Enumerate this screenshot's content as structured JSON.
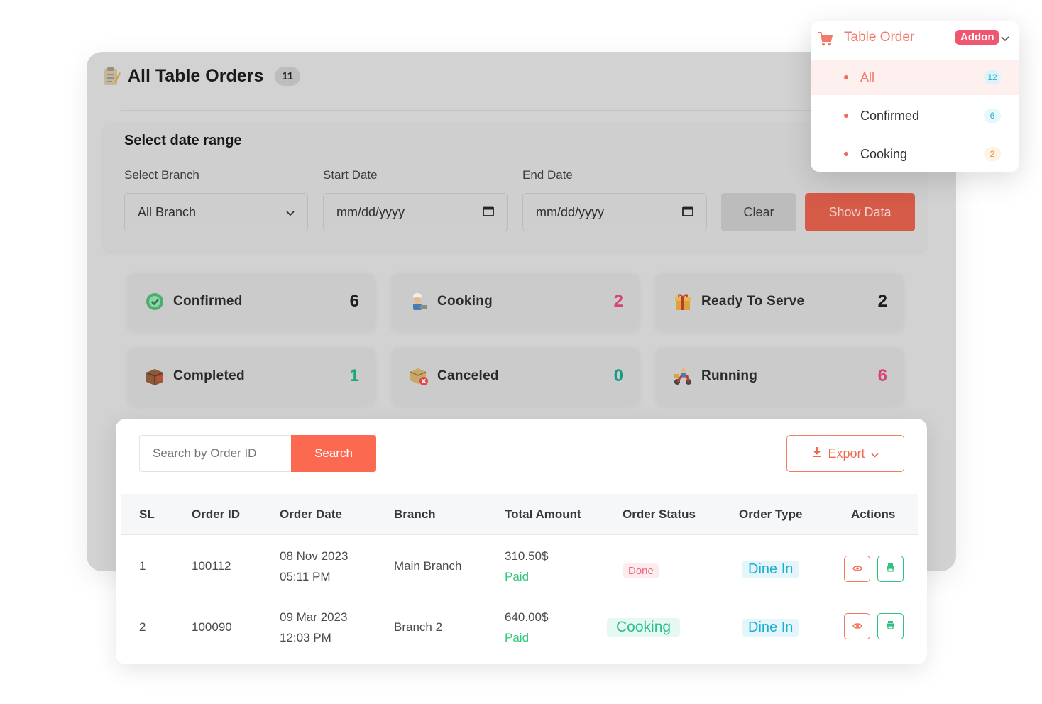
{
  "header": {
    "title": "All Table Orders",
    "count": "11"
  },
  "filter": {
    "title": "Select date range",
    "branch_label": "Select Branch",
    "branch_value": "All Branch",
    "start_label": "Start Date",
    "start_placeholder": "mm/dd/yyyy",
    "end_label": "End Date",
    "end_placeholder": "mm/dd/yyyy",
    "clear_label": "Clear",
    "show_label": "Show Data"
  },
  "stats": [
    {
      "label": "Confirmed",
      "value": "6",
      "color": "#1c1c1c",
      "icon": "check-circle-icon"
    },
    {
      "label": "Cooking",
      "value": "2",
      "color": "#d64472",
      "icon": "chef-icon"
    },
    {
      "label": "Ready To Serve",
      "value": "2",
      "color": "#1c1c1c",
      "icon": "gift-box-icon"
    },
    {
      "label": "Completed",
      "value": "1",
      "color": "#1aa874",
      "icon": "package-icon"
    },
    {
      "label": "Canceled",
      "value": "0",
      "color": "#139c86",
      "icon": "cancel-box-icon"
    },
    {
      "label": "Running",
      "value": "6",
      "color": "#d64472",
      "icon": "delivery-scooter-icon"
    }
  ],
  "orders": {
    "search_placeholder": "Search by Order ID",
    "search_button": "Search",
    "export_label": "Export",
    "columns": [
      "SL",
      "Order ID",
      "Order Date",
      "Branch",
      "Total Amount",
      "Order Status",
      "Order Type",
      "Actions"
    ],
    "rows": [
      {
        "sl": "1",
        "order_id": "100112",
        "date": "08 Nov 2023",
        "time": "05:11 PM",
        "branch": "Main Branch",
        "amount": "310.50$",
        "payment": "Paid",
        "status": "Done",
        "type": "Dine In"
      },
      {
        "sl": "2",
        "order_id": "100090",
        "date": "09 Mar 2023",
        "time": "12:03 PM",
        "branch": "Branch 2",
        "amount": "640.00$",
        "payment": "Paid",
        "status": "Cooking",
        "type": "Dine In"
      }
    ]
  },
  "dropdown": {
    "title": "Table Order",
    "badge": "Addon",
    "items": [
      {
        "label": "All",
        "count": "12"
      },
      {
        "label": "Confirmed",
        "count": "6"
      },
      {
        "label": "Cooking",
        "count": "2"
      }
    ]
  },
  "colors": {
    "accent": "#fb6a50",
    "success": "#34c77e",
    "info": "#1eaed3",
    "danger": "#f0566e"
  }
}
